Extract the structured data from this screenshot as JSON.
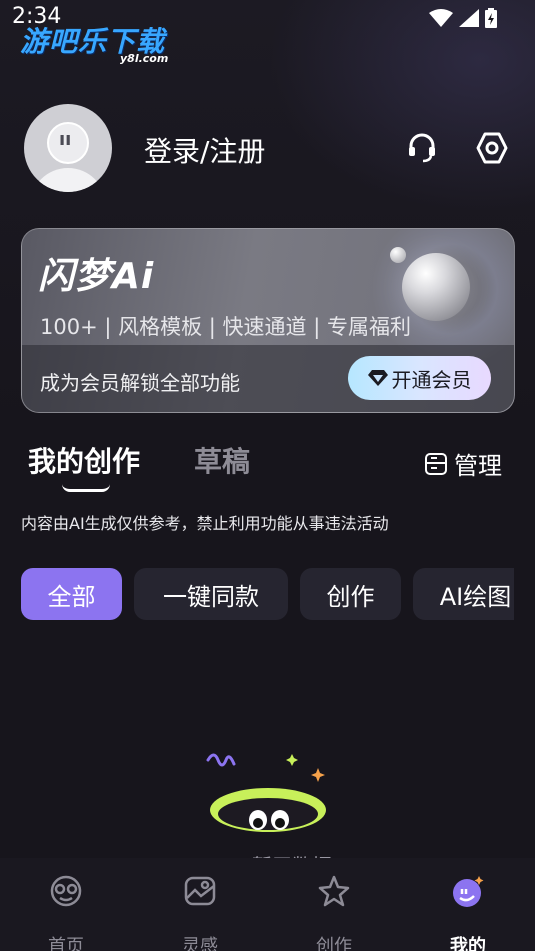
{
  "status_bar": {
    "time": "2:34"
  },
  "watermark": {
    "brand": "游吧乐下载",
    "domain": "y8l.com"
  },
  "profile": {
    "login_label": "登录/注册"
  },
  "vip_card": {
    "logo": "闪梦Ai",
    "features": "100+ | 风格模板 | 快速通道 | 专属福利",
    "promo": "成为会员解锁全部功能",
    "button_label": "开通会员"
  },
  "tabs": {
    "active": "我的创作",
    "inactive": "草稿",
    "manage_label": "管理"
  },
  "disclaimer": "内容由AI生成仅供参考，禁止利用功能从事违法活动",
  "filter_chips": [
    {
      "label": "全部",
      "active": true
    },
    {
      "label": "一键同款",
      "active": false
    },
    {
      "label": "创作",
      "active": false
    },
    {
      "label": "AI绘图",
      "active": false
    }
  ],
  "empty_state": {
    "text": "暂无数据"
  },
  "bottom_nav": [
    {
      "label": "首页",
      "icon": "home-face-icon",
      "active": false
    },
    {
      "label": "灵感",
      "icon": "inspiration-icon",
      "active": false
    },
    {
      "label": "创作",
      "icon": "create-star-icon",
      "active": false
    },
    {
      "label": "我的",
      "icon": "profile-icon",
      "active": true
    }
  ],
  "colors": {
    "background": "#17151c",
    "accent": "#8c74f0",
    "chip_bg": "#262530",
    "nav_bg": "#1a1820"
  }
}
